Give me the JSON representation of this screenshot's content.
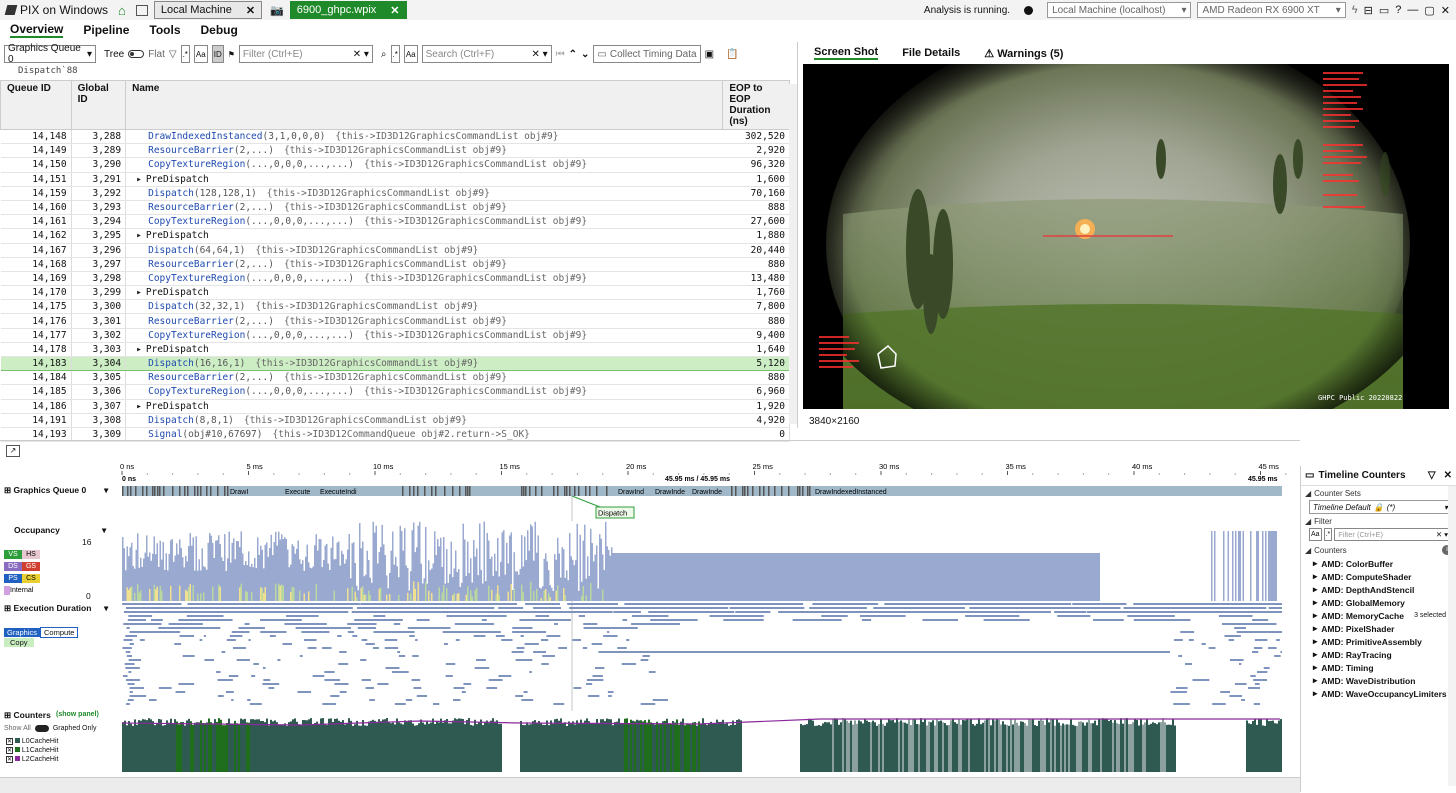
{
  "title_bar": {
    "app_name": "PIX on Windows",
    "tabs": [
      {
        "label": "Local Machine"
      },
      {
        "label": "6900_ghpc.wpix"
      }
    ],
    "analysis_status": "Analysis is running.",
    "machine": "Local Machine (localhost)",
    "gpu": "AMD Radeon RX 6900 XT"
  },
  "menu": [
    "Overview",
    "Pipeline",
    "Tools",
    "Debug"
  ],
  "toolbar": {
    "queue": "Graphics Queue 0",
    "tree": "Tree",
    "flat": "Flat",
    "filter_placeholder": "Filter (Ctrl+E)",
    "search_placeholder": "Search (Ctrl+F)",
    "collect": "Collect Timing Data"
  },
  "breadcrumb": "Dispatch`88",
  "table": {
    "headers": [
      "Queue ID",
      "Global ID",
      "Name",
      "EOP to EOP Duration (ns)"
    ],
    "rows": [
      {
        "q": "14,148",
        "g": "3,288",
        "fn": "DrawIndexedInstanced",
        "args": "(3,1,0,0,0)",
        "tail": "{this->ID3D12GraphicsCommandList obj#9}",
        "d": "302,520"
      },
      {
        "q": "14,149",
        "g": "3,289",
        "fn": "ResourceBarrier",
        "args": "(2,...)",
        "tail": "{this->ID3D12GraphicsCommandList obj#9}",
        "d": "2,920"
      },
      {
        "q": "14,150",
        "g": "3,290",
        "fn": "CopyTextureRegion",
        "args": "(...,0,0,0,...,...)",
        "tail": "{this->ID3D12GraphicsCommandList obj#9}",
        "d": "96,320"
      },
      {
        "q": "14,151",
        "g": "3,291",
        "fn": "PreDispatch",
        "args": "",
        "tail": "",
        "d": "1,600",
        "group": true
      },
      {
        "q": "14,159",
        "g": "3,292",
        "fn": "Dispatch",
        "args": "(128,128,1)",
        "tail": "{this->ID3D12GraphicsCommandList obj#9}",
        "d": "70,160"
      },
      {
        "q": "14,160",
        "g": "3,293",
        "fn": "ResourceBarrier",
        "args": "(2,...)",
        "tail": "{this->ID3D12GraphicsCommandList obj#9}",
        "d": "888"
      },
      {
        "q": "14,161",
        "g": "3,294",
        "fn": "CopyTextureRegion",
        "args": "(...,0,0,0,...,...)",
        "tail": "{this->ID3D12GraphicsCommandList obj#9}",
        "d": "27,600"
      },
      {
        "q": "14,162",
        "g": "3,295",
        "fn": "PreDispatch",
        "args": "",
        "tail": "",
        "d": "1,880",
        "group": true
      },
      {
        "q": "14,167",
        "g": "3,296",
        "fn": "Dispatch",
        "args": "(64,64,1)",
        "tail": "{this->ID3D12GraphicsCommandList obj#9}",
        "d": "20,440"
      },
      {
        "q": "14,168",
        "g": "3,297",
        "fn": "ResourceBarrier",
        "args": "(2,...)",
        "tail": "{this->ID3D12GraphicsCommandList obj#9}",
        "d": "880"
      },
      {
        "q": "14,169",
        "g": "3,298",
        "fn": "CopyTextureRegion",
        "args": "(...,0,0,0,...,...)",
        "tail": "{this->ID3D12GraphicsCommandList obj#9}",
        "d": "13,480"
      },
      {
        "q": "14,170",
        "g": "3,299",
        "fn": "PreDispatch",
        "args": "",
        "tail": "",
        "d": "1,760",
        "group": true
      },
      {
        "q": "14,175",
        "g": "3,300",
        "fn": "Dispatch",
        "args": "(32,32,1)",
        "tail": "{this->ID3D12GraphicsCommandList obj#9}",
        "d": "7,800"
      },
      {
        "q": "14,176",
        "g": "3,301",
        "fn": "ResourceBarrier",
        "args": "(2,...)",
        "tail": "{this->ID3D12GraphicsCommandList obj#9}",
        "d": "880"
      },
      {
        "q": "14,177",
        "g": "3,302",
        "fn": "CopyTextureRegion",
        "args": "(...,0,0,0,...,...)",
        "tail": "{this->ID3D12GraphicsCommandList obj#9}",
        "d": "9,400"
      },
      {
        "q": "14,178",
        "g": "3,303",
        "fn": "PreDispatch",
        "args": "",
        "tail": "",
        "d": "1,640",
        "group": true
      },
      {
        "q": "14,183",
        "g": "3,304",
        "fn": "Dispatch",
        "args": "(16,16,1)",
        "tail": "{this->ID3D12GraphicsCommandList obj#9}",
        "d": "5,120",
        "hl": true
      },
      {
        "q": "14,184",
        "g": "3,305",
        "fn": "ResourceBarrier",
        "args": "(2,...)",
        "tail": "{this->ID3D12GraphicsCommandList obj#9}",
        "d": "880"
      },
      {
        "q": "14,185",
        "g": "3,306",
        "fn": "CopyTextureRegion",
        "args": "(...,0,0,0,...,...)",
        "tail": "{this->ID3D12GraphicsCommandList obj#9}",
        "d": "6,960"
      },
      {
        "q": "14,186",
        "g": "3,307",
        "fn": "PreDispatch",
        "args": "",
        "tail": "",
        "d": "1,920",
        "group": true
      },
      {
        "q": "14,191",
        "g": "3,308",
        "fn": "Dispatch",
        "args": "(8,8,1)",
        "tail": "{this->ID3D12GraphicsCommandList obj#9}",
        "d": "4,920"
      },
      {
        "q": "14,193",
        "g": "3,309",
        "fn": "Signal",
        "args": "(obj#10,67697)",
        "tail": "{this->ID3D12CommandQueue obj#2.return->S_OK}",
        "d": "0"
      }
    ]
  },
  "right_tabs": [
    "Screen Shot",
    "File Details",
    "Warnings (5)"
  ],
  "resolution": "3840×2160",
  "screenshot_text": {
    "watermark": "GHPC Public 20220822"
  },
  "timeline": {
    "ticks": [
      "0 ns",
      "5 ms",
      "10 ms",
      "15 ms",
      "20 ms",
      "25 ms",
      "30 ms",
      "35 ms",
      "40 ms",
      "45 ms"
    ],
    "start_label": "0 ns",
    "range_label": "45.95 ms / 45.95 ms",
    "end_label": "45.95 ms",
    "lanes": {
      "queue": "Graphics Queue 0",
      "occupancy": "Occupancy",
      "occ_max": "16",
      "occ_min": "0",
      "exec": "Execution Duration",
      "counters": "Counters",
      "show_panel": "(show panel)",
      "show_all": "Show All",
      "graphed_only": "Graphed Only"
    },
    "event_labels": [
      "DrawI",
      "Execute",
      "ExecuteIndi",
      "DrawInd",
      "DrawInde",
      "DrawInde",
      "DrawIndexedInstanced"
    ],
    "tooltip": "Dispatch",
    "occ_legend": [
      [
        "VS",
        "#2e9e3a"
      ],
      [
        "HS",
        "#e8c8d0"
      ],
      [
        "DS",
        "#8a6cc0"
      ],
      [
        "GS",
        "#d04030"
      ],
      [
        "PS",
        "#2060c0"
      ],
      [
        "CS",
        "#e8d030"
      ],
      [
        "Internal",
        "#d0a0e0"
      ]
    ],
    "exec_legend": [
      "Graphics",
      "Compute",
      "Copy"
    ],
    "counter_legend": [
      "L0CacheHit",
      "L1CacheHit",
      "L2CacheHit"
    ]
  },
  "tl_counters": {
    "title": "Timeline Counters",
    "counter_sets": "Counter Sets",
    "set_value": "Timeline Default",
    "set_suffix": "(*)",
    "filter": "Filter",
    "filter_placeholder": "Filter (Ctrl+E)",
    "counters": "Counters",
    "selected": "3 selected",
    "items": [
      "AMD: ColorBuffer",
      "AMD: ComputeShader",
      "AMD: DepthAndStencil",
      "AMD: GlobalMemory",
      "AMD: MemoryCache",
      "AMD: PixelShader",
      "AMD: PrimitiveAssembly",
      "AMD: RayTracing",
      "AMD: Timing",
      "AMD: WaveDistribution",
      "AMD: WaveOccupancyLimiters"
    ]
  },
  "colors": {
    "accent": "#1e8a2a",
    "highlight": "#cdeec5",
    "occupancy_fill": "#9aa9cf",
    "counter_fill": "#2f5a52"
  }
}
